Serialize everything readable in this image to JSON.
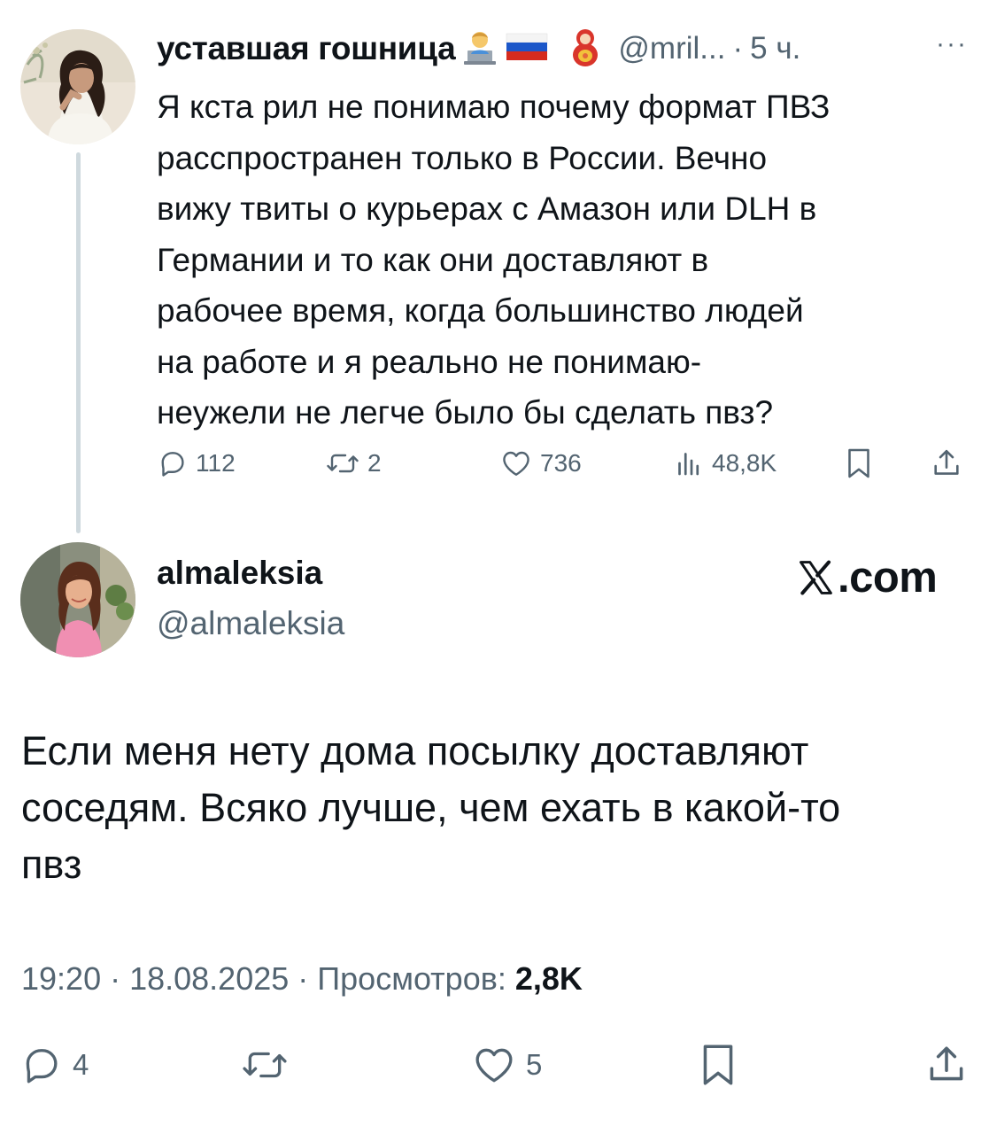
{
  "parent_tweet": {
    "author_name": "уставшая гошница",
    "author_emoji": [
      "technologist",
      "russia-flag",
      "matryoshka"
    ],
    "handle": "@mril...",
    "dot": "·",
    "time": "5 ч.",
    "more": "···",
    "text_lines": [
      "Я кста рил не понимаю почему формат ПВЗ",
      "расспространен только в России. Вечно",
      "вижу твиты о курьерах с Амазон или DLH в",
      "Германии и то как они доставляют в",
      "рабочее время, когда большинство людей",
      "на работе и я реально не понимаю-",
      "неужели не легче было бы сделать пвз?"
    ],
    "stats": {
      "replies": "112",
      "reposts": "2",
      "likes": "736",
      "views": "48,8K"
    }
  },
  "reply_tweet": {
    "author_name": "almaleksia",
    "handle": "@almaleksia",
    "watermark": "X",
    "watermark_suffix": ".com",
    "text_lines": [
      "Если меня нету дома посылку доставляют",
      "соседям. Всяко лучше, чем ехать в какой-то",
      "пвз"
    ],
    "meta": {
      "time": "19:20",
      "date": "18.08.2025",
      "separator": " · ",
      "views_label": "Просмотров: ",
      "views_value": "2,8K"
    },
    "stats": {
      "replies": "4",
      "likes": "5"
    }
  },
  "colors": {
    "text": "#0f1419",
    "muted": "#536471",
    "thread_line": "#cfd9de"
  }
}
